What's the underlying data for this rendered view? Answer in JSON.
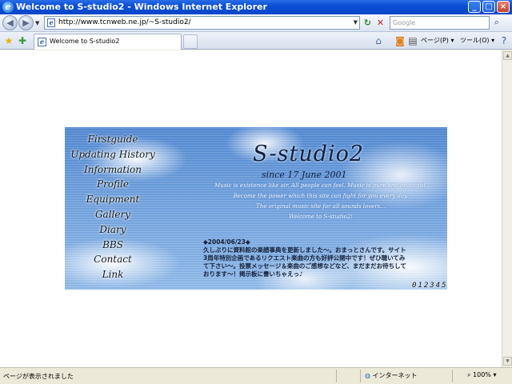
{
  "window": {
    "title": "Welcome to S-studio2 - Windows Internet Explorer",
    "minimize": "_",
    "maximize": "□",
    "close": "×"
  },
  "address": {
    "url": "http://www.tcnweb.ne.jp/~S-studio2/",
    "search_placeholder": "Google"
  },
  "tabs": [
    {
      "label": "Welcome to S-studio2"
    }
  ],
  "toolbar": {
    "page_menu": "ページ(P) ▾",
    "tools_menu": "ツール(O) ▾",
    "help": "?"
  },
  "site": {
    "nav": [
      "Firstguide",
      "Updating History",
      "Information",
      "Profile",
      "Equipment",
      "Gallery",
      "Diary",
      "BBS",
      "Contact",
      "Link"
    ],
    "title": "S-studio2",
    "since": "since 17 June 2001",
    "tagline": [
      "Music is existence like air. All people can feel. Music is pure and beautiful.",
      "Become the power which this site can fight for you every day.",
      "The original music site for all sounds lovers...",
      "Welcome to S-studio2!"
    ],
    "news_date": "◆2004/06/23◆",
    "news_body": "久しぶりに資料館の楽譜事典を更新しました～。おまっとさんです。サイト3周年特別企画であるリクエスト楽曲の方も好評公開中です！ぜひ聴いてみて下さい～。投票メッセージ＆楽曲のご感想などなど、まだまだお待ちしております～！掲示板に書いちゃえっ♪",
    "counter": "012345"
  },
  "status": {
    "message": "ページが表示されました",
    "zone": "インターネット",
    "zoom": "100%"
  }
}
